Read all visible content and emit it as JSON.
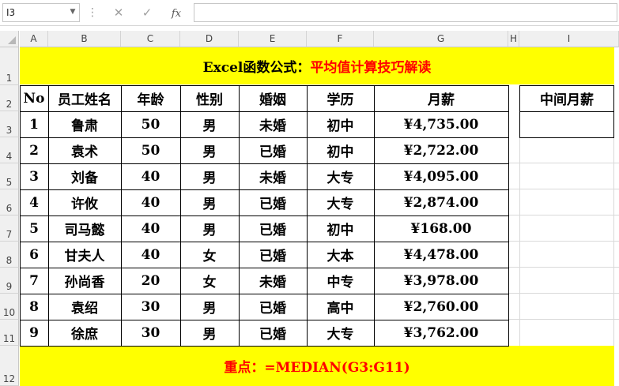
{
  "formula_bar": {
    "name_box": "I3",
    "fx_label": "fx",
    "cancel_icon": "close-icon",
    "enter_icon": "check-icon"
  },
  "columns": [
    "A",
    "B",
    "C",
    "D",
    "E",
    "F",
    "G",
    "H",
    "I"
  ],
  "rows": [
    "1",
    "2",
    "3",
    "4",
    "5",
    "6",
    "7",
    "8",
    "9",
    "10",
    "11",
    "12"
  ],
  "title": {
    "black": "Excel函数公式：",
    "red": "平均值计算技巧解读"
  },
  "table": {
    "headers": [
      "No",
      "员工姓名",
      "年龄",
      "性别",
      "婚姻",
      "学历",
      "月薪"
    ],
    "rows": [
      [
        "1",
        "鲁肃",
        "50",
        "男",
        "未婚",
        "初中",
        "¥4,735.00"
      ],
      [
        "2",
        "袁术",
        "50",
        "男",
        "已婚",
        "初中",
        "¥2,722.00"
      ],
      [
        "3",
        "刘备",
        "40",
        "男",
        "未婚",
        "大专",
        "¥4,095.00"
      ],
      [
        "4",
        "许攸",
        "40",
        "男",
        "已婚",
        "大专",
        "¥2,874.00"
      ],
      [
        "5",
        "司马懿",
        "40",
        "男",
        "已婚",
        "初中",
        "¥168.00"
      ],
      [
        "6",
        "甘夫人",
        "40",
        "女",
        "已婚",
        "大本",
        "¥4,478.00"
      ],
      [
        "7",
        "孙尚香",
        "20",
        "女",
        "未婚",
        "中专",
        "¥3,978.00"
      ],
      [
        "8",
        "袁绍",
        "30",
        "男",
        "已婚",
        "高中",
        "¥2,760.00"
      ],
      [
        "9",
        "徐庶",
        "30",
        "男",
        "已婚",
        "大专",
        "¥3,762.00"
      ]
    ]
  },
  "side": {
    "header": "中间月薪",
    "value": ""
  },
  "footer": {
    "text": "重点：=MEDIAN(G3:G11)"
  },
  "colors": {
    "band": "#ffff00",
    "accent_red": "#ff0000",
    "header_bg": "#f0f0f0"
  }
}
